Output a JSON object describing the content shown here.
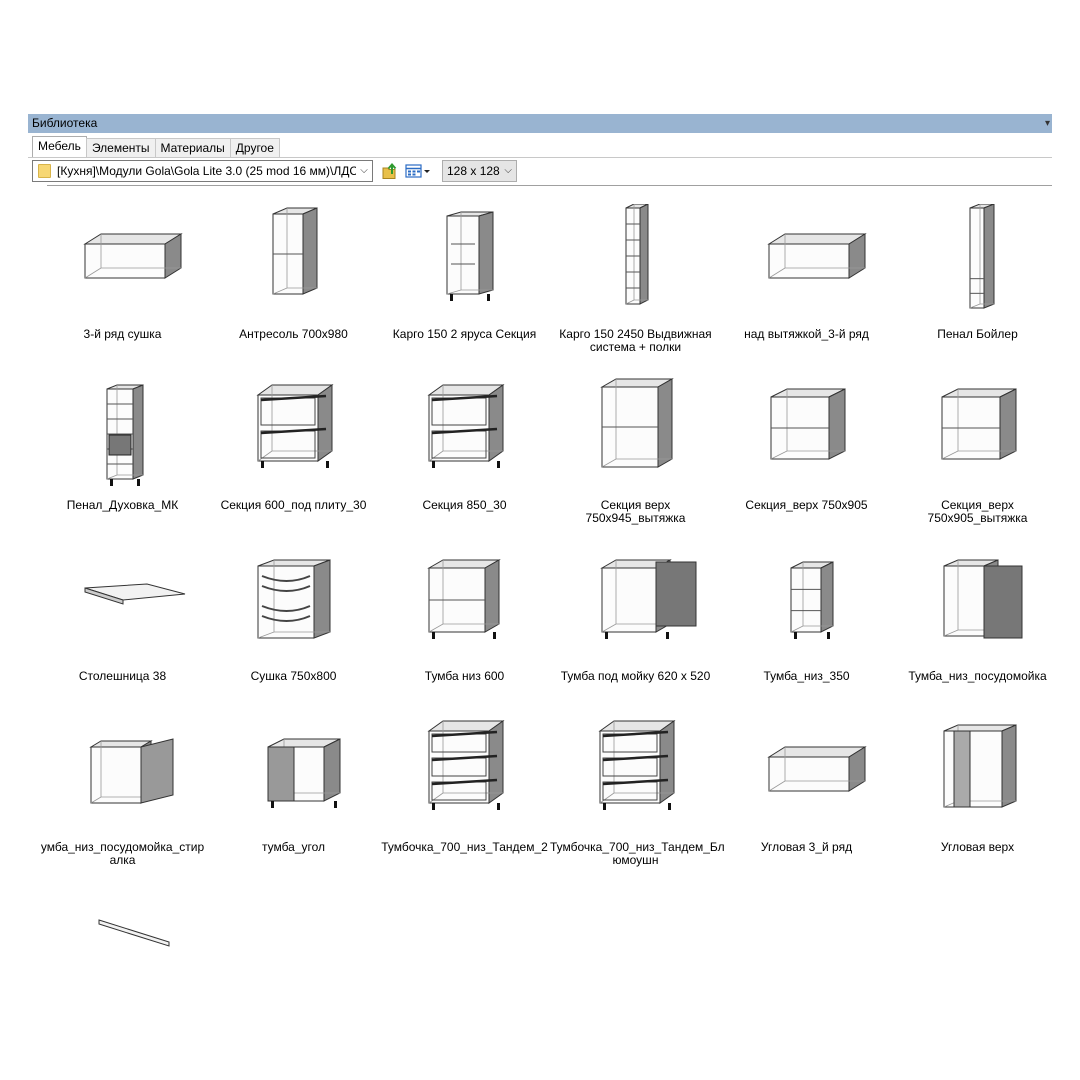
{
  "window": {
    "title": "Библиотека"
  },
  "tabs": [
    {
      "label": "Мебель",
      "active": true
    },
    {
      "label": "Элементы",
      "active": false
    },
    {
      "label": "Материалы",
      "active": false
    },
    {
      "label": "Другое",
      "active": false
    }
  ],
  "toolbar": {
    "path": "[Кухня]\\Модули Gola\\Gola Lite 3.0 (25 mod 16 мм)\\ЛДСП",
    "path_icon": "folder-icon",
    "up_icon": "folder-up-icon",
    "view_icon": "view-mode-icon",
    "thumb_size": "128 x 128"
  },
  "items": [
    {
      "label": "3-й ряд сушка",
      "icon": "wide-cabinet"
    },
    {
      "label": "Антресоль 700х980",
      "icon": "tall-cabinet-2"
    },
    {
      "label": "Карго 150 2 яруса Секция",
      "icon": "cargo-cabinet"
    },
    {
      "label": "Карго 150 2450 Выдвижная система + полки",
      "icon": "column-cabinet"
    },
    {
      "label": "над вытяжкой_3-й ряд",
      "icon": "wide-cabinet"
    },
    {
      "label": "Пенал Бойлер",
      "icon": "narrow-column"
    },
    {
      "label": "Пенал_Духовка_МК",
      "icon": "oven-column"
    },
    {
      "label": "Секция 600_под плиту_30",
      "icon": "drawer-cabinet"
    },
    {
      "label": "Секция 850_30",
      "icon": "drawer-cabinet"
    },
    {
      "label": "Секция верх 750х945_вытяжка",
      "icon": "open-cabinet"
    },
    {
      "label": "Секция_верх 750х905",
      "icon": "open-cabinet-wide"
    },
    {
      "label": "Секция_верх 750х905_вытяжка",
      "icon": "open-cabinet-wide"
    },
    {
      "label": "Столешница 38",
      "icon": "countertop"
    },
    {
      "label": "Сушка 750х800",
      "icon": "dish-rack"
    },
    {
      "label": "Тумба низ 600",
      "icon": "base-cabinet"
    },
    {
      "label": "Тумба под мойку 620 х 520",
      "icon": "sink-cabinet"
    },
    {
      "label": "Тумба_низ_350",
      "icon": "base-cabinet-narrow"
    },
    {
      "label": "Тумба_низ_посудомойка",
      "icon": "dishwasher-panel"
    },
    {
      "label": "умба_низ_посудомойка_стир алка",
      "icon": "dishwasher-panel-2"
    },
    {
      "label": "тумба_угол",
      "icon": "corner-base"
    },
    {
      "label": "Тумбочка_700_низ_Тандем_2",
      "icon": "drawer-cabinet-3"
    },
    {
      "label": "Тумбочка_700_низ_Тандем_Бл юмоушн",
      "icon": "drawer-cabinet-3"
    },
    {
      "label": "Угловая 3_й ряд",
      "icon": "wide-cabinet"
    },
    {
      "label": "Угловая верх",
      "icon": "corner-upper"
    },
    {
      "label": "",
      "icon": "plinth-strip"
    }
  ]
}
